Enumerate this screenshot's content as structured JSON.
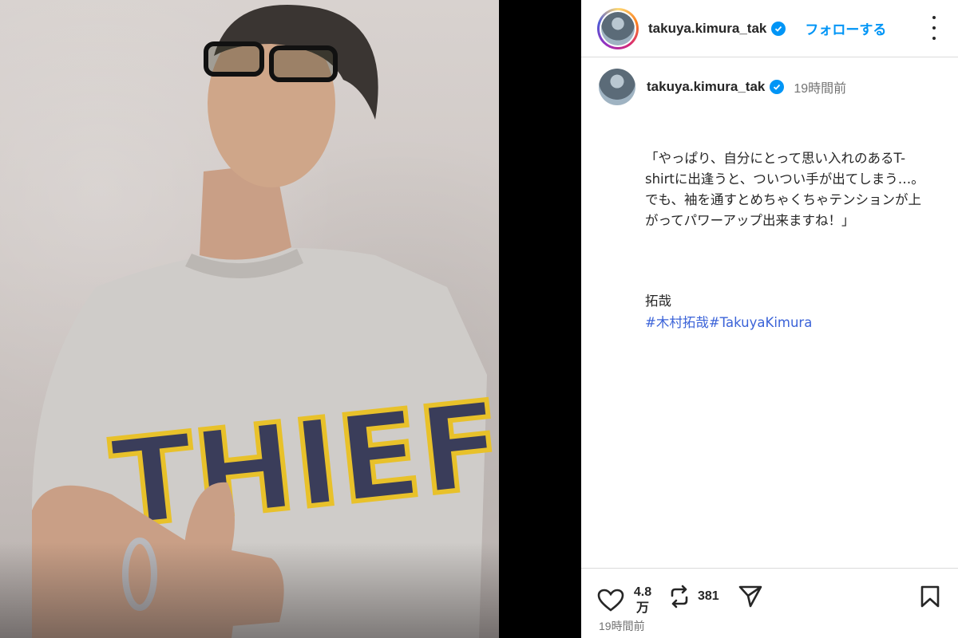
{
  "post": {
    "username": "takuya.kimura_tak",
    "follow_label": "フォローする",
    "time_ago": "19時間前",
    "caption_lines": "「やっぱり、自分にとって思い入れのあるT-shirtに出逢うと、ついつい手が出てしまう…。\nでも、袖を通すとめちゃくちゃテンションが上がってパワーアップ出来ますね！」",
    "signature": "拓哉",
    "hashtags": [
      "#木村拓哉",
      "#TakuyaKimura"
    ],
    "shirt_text": "THIEFS"
  },
  "actions": {
    "likes": "4.8",
    "likes_unit": "万",
    "reposts": "381",
    "footer_time": "19時間前"
  },
  "icons": {
    "verified": "verified-badge-icon",
    "more": "more-options-icon",
    "like": "heart-icon",
    "repost": "repost-icon",
    "share": "paper-plane-icon",
    "save": "bookmark-icon"
  },
  "colors": {
    "accent_blue": "#0095f6",
    "hashtag_blue": "#3b63d8",
    "muted": "#737373"
  }
}
